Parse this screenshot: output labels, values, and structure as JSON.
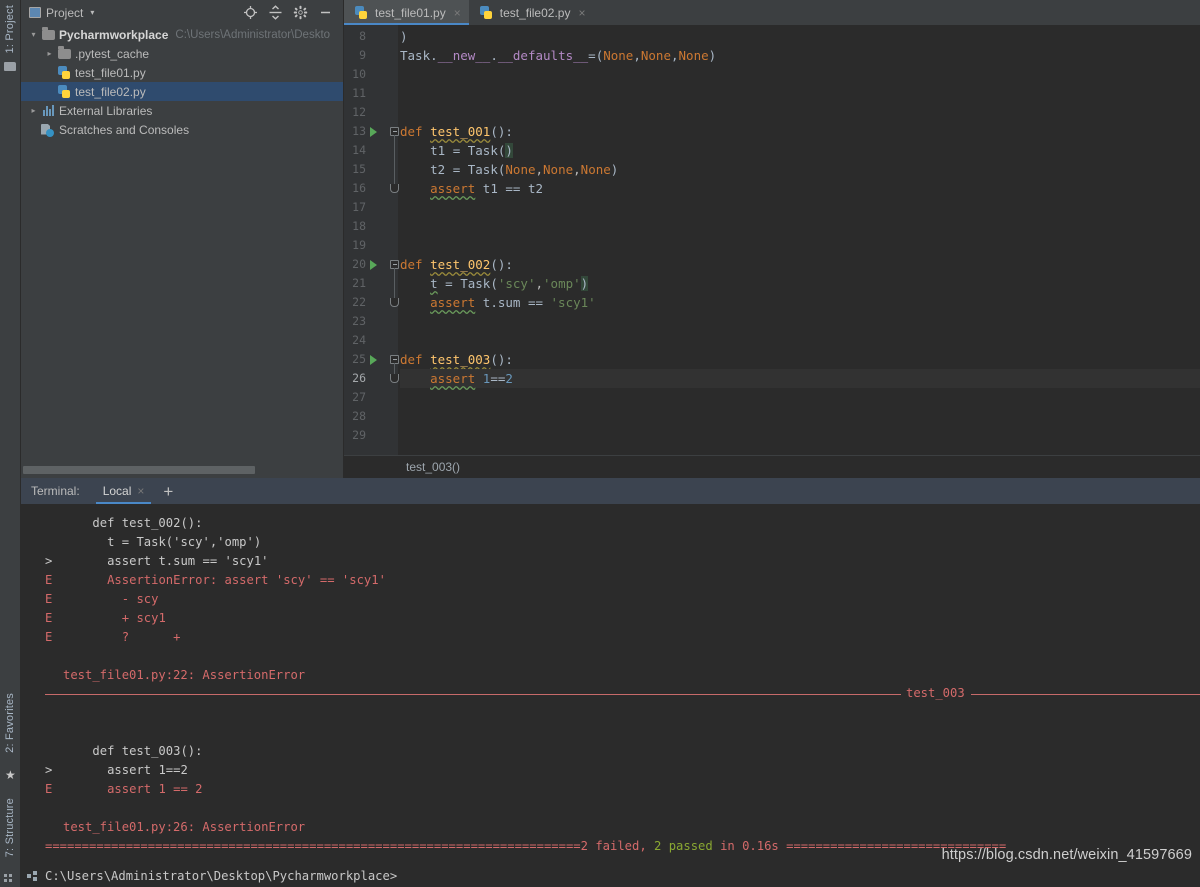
{
  "window": {
    "left_strips": {
      "top_label": "1: Project",
      "bottom_labels": [
        "2: Favorites",
        "7: Structure"
      ]
    }
  },
  "project_panel": {
    "title": "Project",
    "title_icon": "project-icon",
    "caret": "▾",
    "toolbar": [
      {
        "name": "locate-icon",
        "label": "⊕"
      },
      {
        "name": "collapse-all-icon",
        "label": "⥮"
      },
      {
        "name": "settings-gear-icon",
        "label": "✿"
      },
      {
        "name": "hide-panel-icon",
        "label": "—"
      }
    ],
    "tree": [
      {
        "arrow": "▾",
        "icon": "folder-icon",
        "label": "Pycharmworkplace",
        "bold": true,
        "path": "C:\\Users\\Administrator\\Deskto",
        "indent": 0,
        "selected": false
      },
      {
        "arrow": "▸",
        "icon": "folder-icon",
        "label": ".pytest_cache",
        "bold": false,
        "path": "",
        "indent": 1,
        "selected": false
      },
      {
        "arrow": "",
        "icon": "python-file-icon",
        "label": "test_file01.py",
        "bold": false,
        "path": "",
        "indent": 1,
        "selected": false
      },
      {
        "arrow": "",
        "icon": "python-file-icon",
        "label": "test_file02.py",
        "bold": false,
        "path": "",
        "indent": 1,
        "selected": true
      },
      {
        "arrow": "▸",
        "icon": "external-libraries-icon",
        "label": "External Libraries",
        "bold": false,
        "path": "",
        "indent": 0,
        "selected": false
      },
      {
        "arrow": "",
        "icon": "scratches-icon",
        "label": "Scratches and Consoles",
        "bold": false,
        "path": "",
        "indent": 0,
        "selected": false
      }
    ]
  },
  "editor": {
    "tabs": [
      {
        "label": "test_file01.py",
        "icon": "python-file-icon",
        "active": true,
        "close": "×"
      },
      {
        "label": "test_file02.py",
        "icon": "python-file-icon",
        "active": false,
        "close": "×"
      }
    ],
    "first_line_number": 8,
    "lines": [
      {
        "n": 8,
        "run": false,
        "fold": "",
        "text": ")"
      },
      {
        "n": 9,
        "run": false,
        "fold": "",
        "text": "Task.__new__.__defaults__=(None,None,None)"
      },
      {
        "n": 10,
        "run": false,
        "fold": "",
        "text": ""
      },
      {
        "n": 11,
        "run": false,
        "fold": "",
        "text": ""
      },
      {
        "n": 12,
        "run": false,
        "fold": "",
        "text": ""
      },
      {
        "n": 13,
        "run": true,
        "fold": "start",
        "text": "def test_001():"
      },
      {
        "n": 14,
        "run": false,
        "fold": "",
        "text": "    t1 = Task()"
      },
      {
        "n": 15,
        "run": false,
        "fold": "",
        "text": "    t2 = Task(None,None,None)"
      },
      {
        "n": 16,
        "run": false,
        "fold": "end",
        "text": "    assert t1 == t2"
      },
      {
        "n": 17,
        "run": false,
        "fold": "",
        "text": ""
      },
      {
        "n": 18,
        "run": false,
        "fold": "",
        "text": ""
      },
      {
        "n": 19,
        "run": false,
        "fold": "",
        "text": ""
      },
      {
        "n": 20,
        "run": true,
        "fold": "start",
        "text": "def test_002():"
      },
      {
        "n": 21,
        "run": false,
        "fold": "",
        "text": "    t = Task('scy','omp')"
      },
      {
        "n": 22,
        "run": false,
        "fold": "end",
        "text": "    assert t.sum == 'scy1'"
      },
      {
        "n": 23,
        "run": false,
        "fold": "",
        "text": ""
      },
      {
        "n": 24,
        "run": false,
        "fold": "",
        "text": ""
      },
      {
        "n": 25,
        "run": true,
        "fold": "start",
        "text": "def test_003():"
      },
      {
        "n": 26,
        "run": false,
        "fold": "end",
        "text": "    assert 1==2"
      },
      {
        "n": 27,
        "run": false,
        "fold": "",
        "text": ""
      },
      {
        "n": 28,
        "run": false,
        "fold": "",
        "text": ""
      },
      {
        "n": 29,
        "run": false,
        "fold": "",
        "text": ""
      }
    ],
    "breadcrumb": "test_003()"
  },
  "terminal": {
    "label": "Terminal:",
    "tabs": [
      {
        "label": "Local",
        "close": "×",
        "active": true
      }
    ],
    "add_tab": "+",
    "output": [
      {
        "mark": "",
        "text": "def test_002():",
        "color": "grey",
        "indent": 4
      },
      {
        "mark": "",
        "text": "t = Task('scy','omp')",
        "color": "grey",
        "indent": 6
      },
      {
        "mark": ">",
        "text": "assert t.sum == 'scy1'",
        "color": "grey",
        "indent": 6
      },
      {
        "mark": "E",
        "text": "AssertionError: assert 'scy' == 'scy1'",
        "color": "red",
        "indent": 6
      },
      {
        "mark": "E",
        "text": "- scy",
        "color": "red",
        "indent": 8
      },
      {
        "mark": "E",
        "text": "+ scy1",
        "color": "red",
        "indent": 8
      },
      {
        "mark": "E",
        "text": "?      +",
        "color": "red",
        "indent": 8
      },
      {
        "mark": "",
        "text": "",
        "color": "grey",
        "indent": 0
      },
      {
        "mark": "",
        "text": "test_file01.py:22: AssertionError",
        "color": "red",
        "indent": 0
      },
      {
        "mark": "",
        "text": "",
        "color": "grey",
        "indent": 0
      },
      {
        "mark": "",
        "text": "",
        "color": "grey",
        "indent": 0
      },
      {
        "mark": "",
        "text": "def test_003():",
        "color": "grey",
        "indent": 4
      },
      {
        "mark": ">",
        "text": "assert 1==2",
        "color": "grey",
        "indent": 6
      },
      {
        "mark": "E",
        "text": "assert 1 == 2",
        "color": "red",
        "indent": 6
      },
      {
        "mark": "",
        "text": "",
        "color": "grey",
        "indent": 0
      },
      {
        "mark": "",
        "text": "test_file01.py:26: AssertionError",
        "color": "red",
        "indent": 0
      }
    ],
    "section_rule_label": "test_003",
    "eq_separator_char": "=",
    "summary": {
      "prefix_eq": "=========================================================================",
      "failed": "2 failed",
      "comma": ", ",
      "passed": "2 passed",
      "duration": " in 0.16s ",
      "suffix_eq": "=============================="
    },
    "prompt": "C:\\Users\\Administrator\\Desktop\\Pycharmworkplace>",
    "prompt_icon": "terminal-prompt-icon"
  },
  "watermark": "https://blog.csdn.net/weixin_41597669",
  "colors": {
    "panel_bg": "#3c3f41",
    "editor_bg": "#2b2b2b",
    "gutter_bg": "#313335",
    "selection_blue": "#2f4b6e",
    "accent_blue": "#4a88c7",
    "terminal_header": "#3c4450",
    "error_red": "#d46a6a",
    "pass_green": "#8aa832",
    "keyword_orange": "#cc7832",
    "function_yellow": "#ffc66d",
    "string_green": "#6a8759",
    "number_blue": "#6897bb",
    "magic_purple": "#b389c5",
    "text_default": "#a9b7c6"
  }
}
